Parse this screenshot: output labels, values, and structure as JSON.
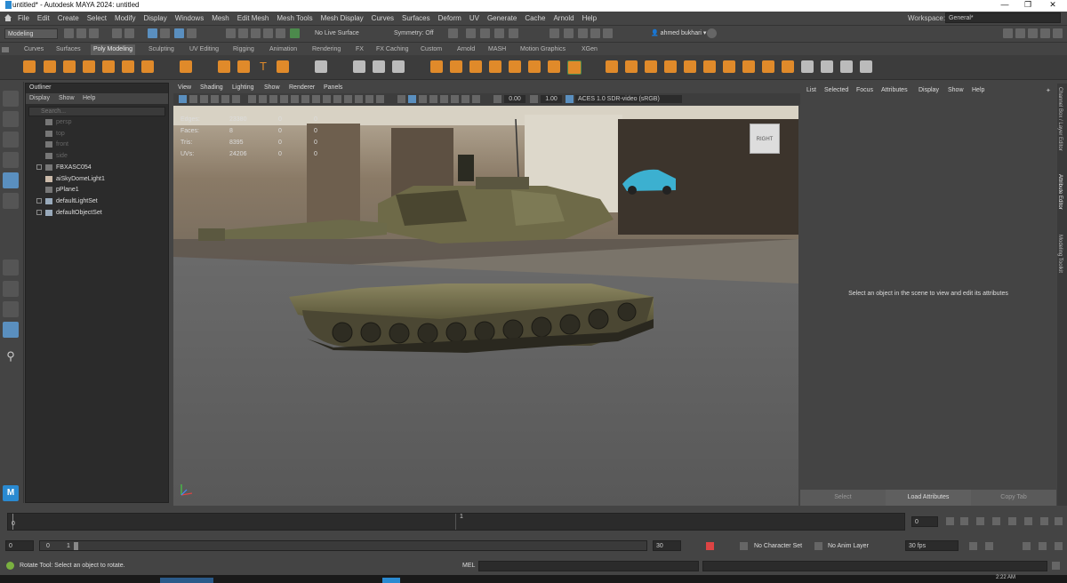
{
  "window": {
    "title": "untitled* - Autodesk MAYA 2024: untitled"
  },
  "menu": [
    "File",
    "Edit",
    "Create",
    "Select",
    "Modify",
    "Display",
    "Windows",
    "Mesh",
    "Edit Mesh",
    "Mesh Tools",
    "Mesh Display",
    "Curves",
    "Surfaces",
    "Deform",
    "UV",
    "Generate",
    "Cache",
    "Arnold",
    "Help"
  ],
  "workspace": {
    "label": "Workspace:",
    "value": "General*"
  },
  "status_line": {
    "mode": "Modeling",
    "live_surface": "No Live Surface",
    "symmetry": "Symmetry: Off",
    "user": "ahmed bukhari"
  },
  "shelf_tabs": [
    "Curves",
    "Surfaces",
    "Poly Modeling",
    "Sculpting",
    "UV Editing",
    "Rigging",
    "Animation",
    "Rendering",
    "FX",
    "FX Caching",
    "Custom",
    "Arnold",
    "MASH",
    "Motion Graphics",
    "XGen"
  ],
  "shelf_active": "Poly Modeling",
  "outliner": {
    "title": "Outliner",
    "menu": [
      "Display",
      "Show",
      "Help"
    ],
    "search_placeholder": "Search...",
    "items": [
      {
        "label": "persp",
        "dim": true
      },
      {
        "label": "top",
        "dim": true
      },
      {
        "label": "front",
        "dim": true
      },
      {
        "label": "side",
        "dim": true
      },
      {
        "label": "FBXASC054",
        "dim": false
      },
      {
        "label": "aiSkyDomeLight1",
        "dim": false
      },
      {
        "label": "pPlane1",
        "dim": false
      },
      {
        "label": "defaultLightSet",
        "dim": false
      },
      {
        "label": "defaultObjectSet",
        "dim": false
      }
    ]
  },
  "viewport": {
    "menu": [
      "View",
      "Shading",
      "Lighting",
      "Show",
      "Renderer",
      "Panels"
    ],
    "exposure": "0.00",
    "gamma": "1.00",
    "color_management": "ACES 1.0 SDR-video (sRGB)",
    "view_cube_label": "RIGHT",
    "hud": [
      {
        "label": "Edges:",
        "v1": "23380",
        "v2": "0",
        "v3": "0"
      },
      {
        "label": "Faces:",
        "v1": "8",
        "v2": "0",
        "v3": "0"
      },
      {
        "label": "Tris:",
        "v1": "8395",
        "v2": "0",
        "v3": "0"
      },
      {
        "label": "UVs:",
        "v1": "24206",
        "v2": "0",
        "v3": "0"
      }
    ]
  },
  "attribute_editor": {
    "menu": [
      "List",
      "Selected",
      "Focus",
      "Attributes",
      "Display",
      "Show",
      "Help"
    ],
    "message": "Select an object in the scene to view and edit its attributes",
    "buttons": [
      "Select",
      "Load Attributes",
      "Copy Tab"
    ]
  },
  "side_tabs": [
    "Channel Box / Layer Editor",
    "Attribute Editor",
    "Modeling Toolkit"
  ],
  "time_slider": {
    "current_frame": "0",
    "start": "0",
    "tick": "1"
  },
  "range": {
    "start": "0",
    "inner_start": "0",
    "inner_end": "1",
    "end": "30",
    "character_set": "No Character Set",
    "anim_layer": "No Anim Layer",
    "fps": "30 fps"
  },
  "command_line": {
    "help": "Rotate Tool: Select an object to rotate.",
    "lang": "MEL"
  },
  "taskbar": {
    "clock": "2:22 AM"
  }
}
